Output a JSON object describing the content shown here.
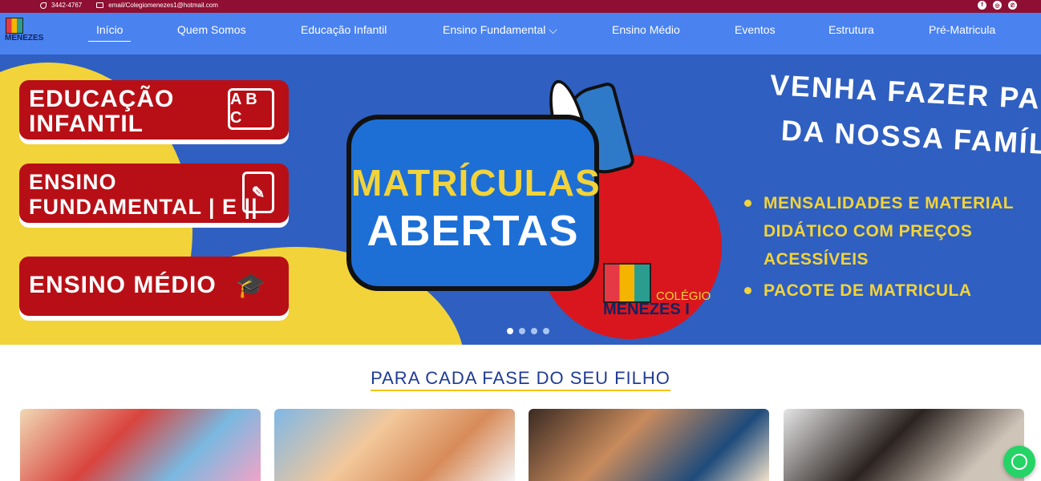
{
  "topbar": {
    "phone": "3442-4767",
    "email": "email/Colegiomenezes1@hotmail.com",
    "social": [
      "facebook-icon",
      "instagram-icon",
      "whatsapp-icon"
    ]
  },
  "logo": {
    "name": "MENEZES"
  },
  "nav": {
    "items": [
      {
        "label": "Início",
        "active": true
      },
      {
        "label": "Quem Somos"
      },
      {
        "label": "Educação Infantil"
      },
      {
        "label": "Ensino Fundamental ⌵"
      },
      {
        "label": "Ensino Médio"
      },
      {
        "label": "Eventos"
      },
      {
        "label": "Estrutura"
      },
      {
        "label": "Pré-Matricula"
      }
    ]
  },
  "hero": {
    "pills": [
      {
        "label": "EDUCAÇÃO\nINFANTIL",
        "deco": "A B C"
      },
      {
        "label": "ENSINO\nFUNDAMENTAL | E ||",
        "deco": "✎"
      },
      {
        "label": "ENSINO MÉDIO",
        "deco": "🎓"
      }
    ],
    "bubble_line1": "MATRÍCULAS",
    "bubble_line2": "ABERTAS",
    "logo_college": "COLÉGIO",
    "logo_name": "MENEZES I",
    "cta_line1": "VENHA FAZER PARTE",
    "cta_line2": "DA NOSSA FAMÍLIA..",
    "bullets": [
      "MENSALIDADES E MATERIAL",
      "DIDÁTICO COM PREÇOS",
      "ACESSÍVEIS",
      "PACOTE DE MATRICULA"
    ],
    "slides": 4,
    "active_slide": 0
  },
  "section": {
    "title": "PARA CADA FASE DO SEU FILHO"
  },
  "colors": {
    "topbar": "#8e0f33",
    "nav": "#4a82ef",
    "accent_yellow": "#f2d33a",
    "brand_red": "#b80f16"
  }
}
